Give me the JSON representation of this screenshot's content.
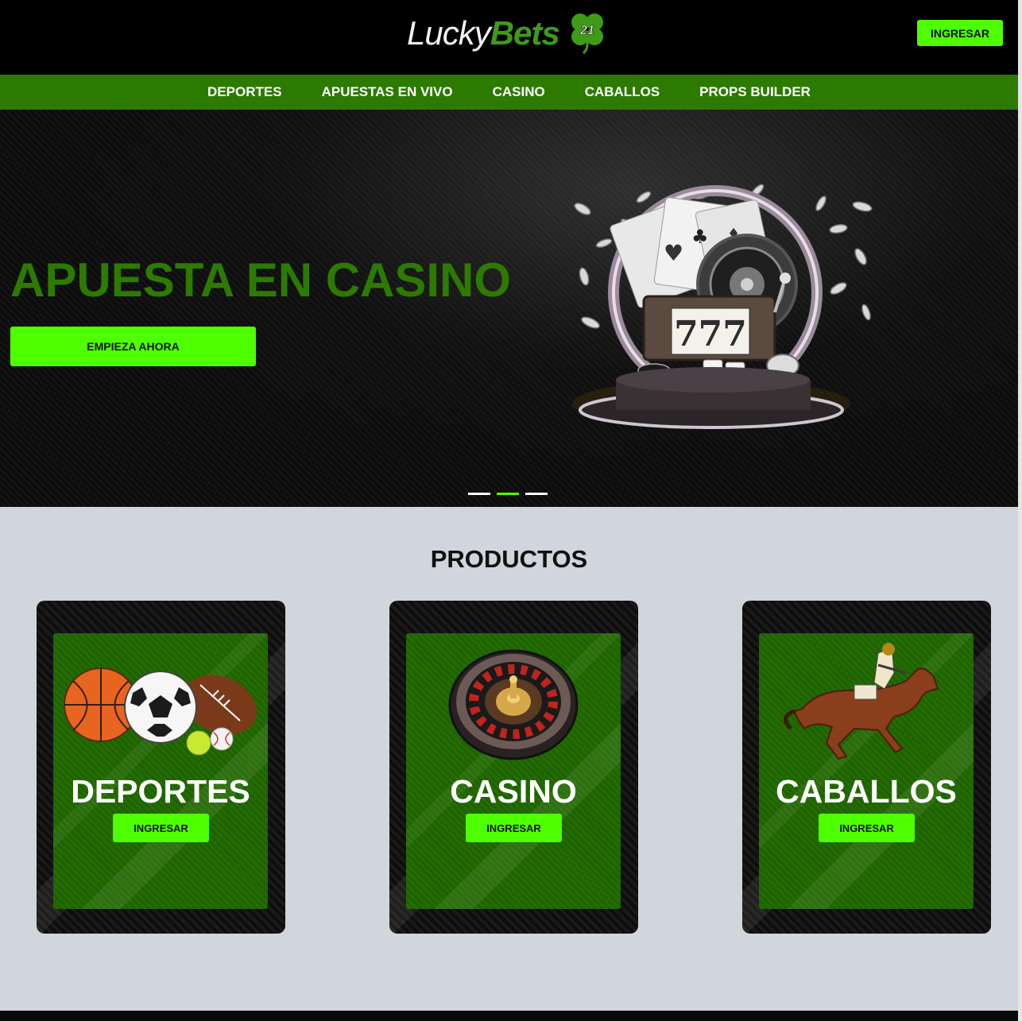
{
  "header": {
    "logo_lucky": "Lucky",
    "logo_bets": "Bets",
    "logo_number": "21",
    "login_label": "INGRESAR"
  },
  "nav": {
    "items": [
      {
        "label": "DEPORTES"
      },
      {
        "label": "APUESTAS EN VIVO"
      },
      {
        "label": "CASINO"
      },
      {
        "label": "CABALLOS"
      },
      {
        "label": "PROPS BUILDER"
      }
    ]
  },
  "hero": {
    "title": "APUESTA EN CASINO",
    "cta_label": "EMPIEZA AHORA",
    "slot_digits": "777",
    "carousel": {
      "slides": 3,
      "active_index": 2
    }
  },
  "products": {
    "title": "PRODUCTOS",
    "cards": [
      {
        "title": "DEPORTES",
        "button": "INGRESAR",
        "icon": "sports-balls-icon"
      },
      {
        "title": "CASINO",
        "button": "INGRESAR",
        "icon": "roulette-wheel-icon"
      },
      {
        "title": "CABALLOS",
        "button": "INGRESAR",
        "icon": "racehorse-icon"
      }
    ]
  },
  "colors": {
    "accent": "#4eff00",
    "nav_green": "#2d7a00",
    "hero_title": "#2d7a00",
    "section_bg": "#d0d5de"
  }
}
